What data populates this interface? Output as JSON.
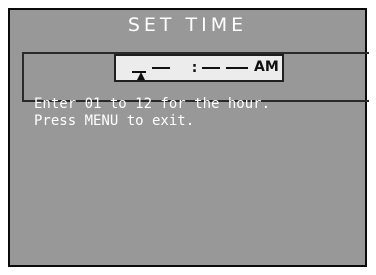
{
  "screen": {
    "title": "SET TIME",
    "time_field": {
      "separator": ":",
      "period": "AM",
      "cursor_position": "hour"
    },
    "instructions": [
      "Enter 01 to 12 for the hour.",
      "Press MENU to exit."
    ]
  },
  "colors": {
    "background": "#989898",
    "text": "#ffffff",
    "field": "#ececec"
  }
}
